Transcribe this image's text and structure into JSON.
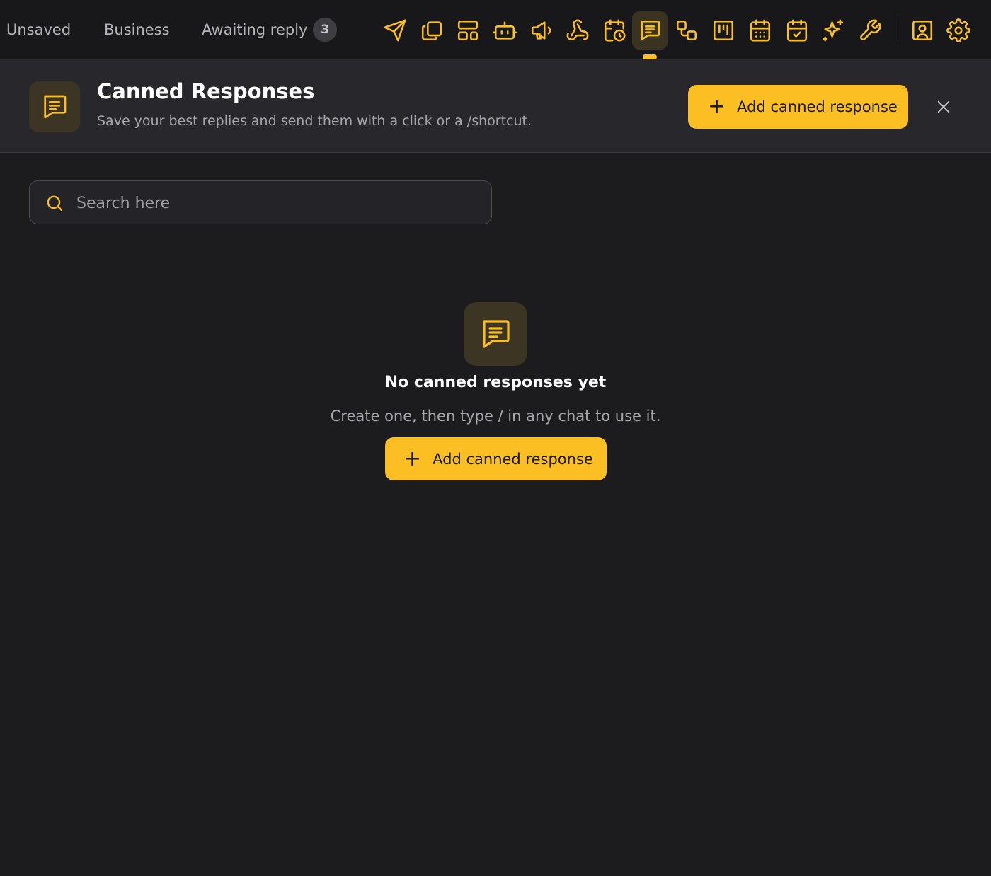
{
  "topbar": {
    "tabs": [
      {
        "label": "Unsaved"
      },
      {
        "label": "Business"
      },
      {
        "label": "Awaiting reply",
        "count": "3"
      }
    ],
    "tools": [
      "send-icon",
      "copy-icon",
      "layout-icon",
      "bot-icon",
      "megaphone-icon",
      "webhook-icon",
      "calendar-clock-icon",
      "message-square-text-icon",
      "workflow-icon",
      "kanban-icon",
      "calendar-grid-icon",
      "calendar-check-icon",
      "sparkles-icon",
      "wrench-icon",
      "contact-icon",
      "settings-icon"
    ],
    "active_tool": "message-square-text-icon",
    "accent_color": "#fbbf24"
  },
  "header": {
    "title": "Canned Responses",
    "subtitle": "Save your best replies and send them with a click or a /shortcut.",
    "add_button_label": "Add canned response"
  },
  "search": {
    "placeholder": "Search here",
    "value": ""
  },
  "empty_state": {
    "title": "No canned responses yet",
    "subtitle": "Create one, then type / in any chat to use it.",
    "button_label": "Add canned response"
  }
}
